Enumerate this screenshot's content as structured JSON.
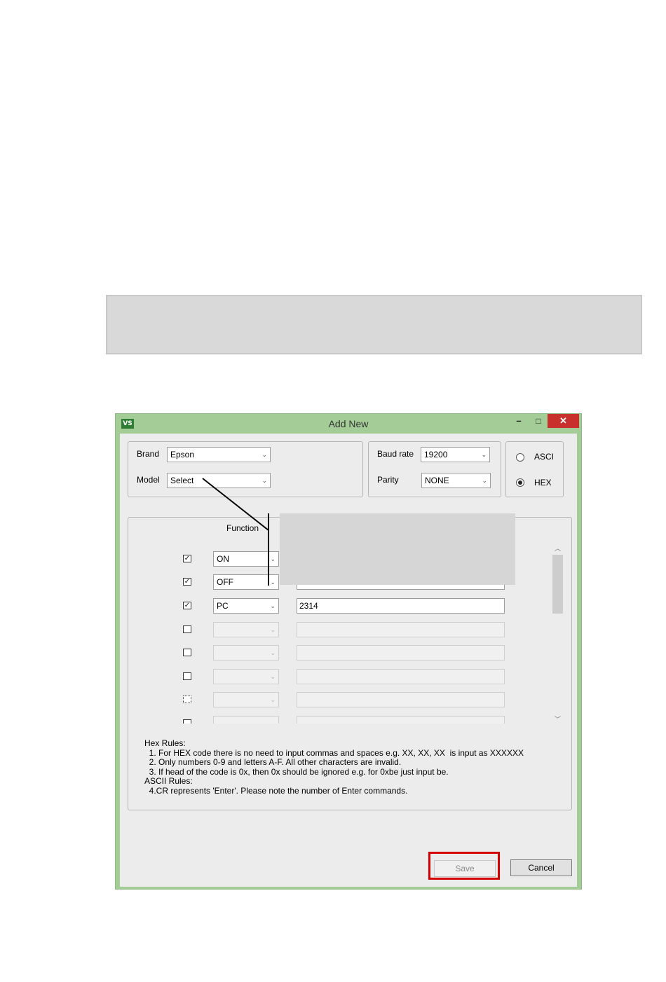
{
  "window": {
    "app_icon": "VS",
    "title": "Add New",
    "minimize": "–",
    "maximize": "□",
    "close": "✕"
  },
  "device": {
    "brand_label": "Brand",
    "brand_value": "Epson",
    "model_label": "Model",
    "model_value": "Select"
  },
  "serial": {
    "baud_label": "Baud rate",
    "baud_value": "19200",
    "parity_label": "Parity",
    "parity_value": "NONE"
  },
  "mode": {
    "ascii_label": "ASCI",
    "hex_label": "HEX",
    "selected": "HEX"
  },
  "function_header": "Function",
  "commands": [
    {
      "checked": true,
      "function": "ON",
      "code": ""
    },
    {
      "checked": true,
      "function": "OFF",
      "code": ""
    },
    {
      "checked": true,
      "function": "PC",
      "code": "2314"
    },
    {
      "checked": false,
      "function": "",
      "code": ""
    },
    {
      "checked": false,
      "function": "",
      "code": ""
    },
    {
      "checked": false,
      "function": "",
      "code": ""
    },
    {
      "checked": false,
      "function": "",
      "code": ""
    }
  ],
  "rules": {
    "hex_title": "Hex Rules:",
    "hex_1": "  1. For HEX code there is no need to input commas and spaces e.g. XX, XX, XX  is input as XXXXXX",
    "hex_2": "  2. Only numbers 0-9 and letters A-F. All other characters are invalid.",
    "hex_3": "  3. If head of the code is 0x, then 0x should be ignored e.g. for 0xbe just input be.",
    "ascii_title": "ASCII Rules:",
    "ascii_1": "  4.CR represents 'Enter'. Please note the number of Enter commands."
  },
  "buttons": {
    "save": "Save",
    "cancel": "Cancel"
  },
  "colors": {
    "window_frame": "#a4cc97",
    "close_button": "#c7302d",
    "highlight": "#d40000"
  }
}
